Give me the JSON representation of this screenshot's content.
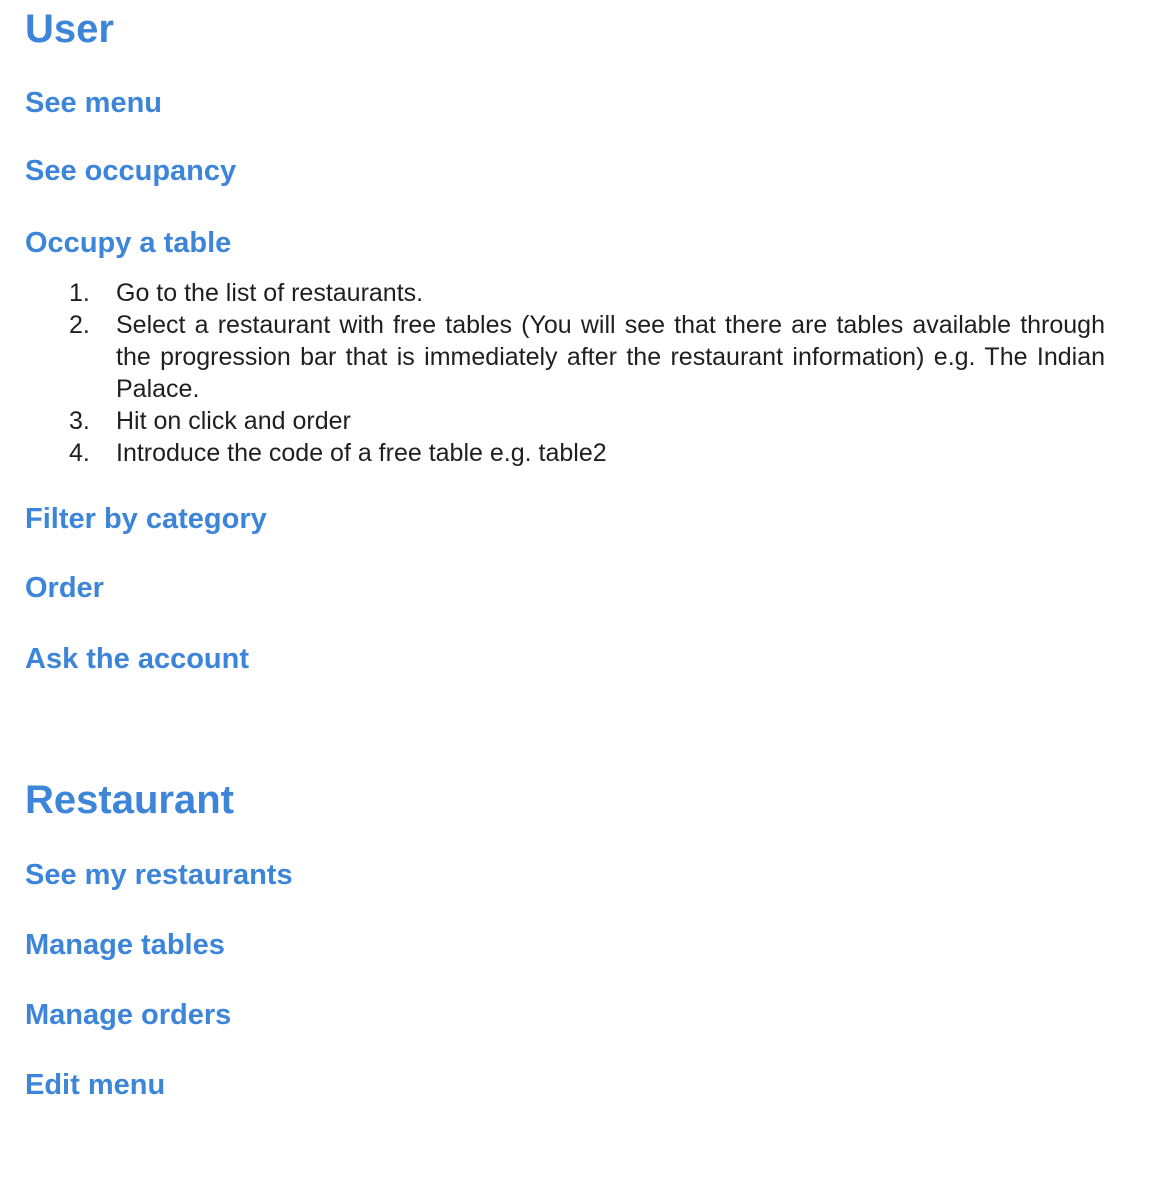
{
  "user": {
    "title": "User",
    "sections": {
      "see_menu": "See menu",
      "see_occupancy": "See occupancy",
      "occupy_table": "Occupy a table",
      "filter_category": "Filter by category",
      "order": "Order",
      "ask_account": "Ask the account"
    },
    "occupy_steps": [
      {
        "num": "1.",
        "text": "Go to the list of restaurants."
      },
      {
        "num": "2.",
        "text": "Select a restaurant with free tables (You will see that there are tables available through the progression bar that is immediately after the restaurant information) e.g. The Indian Palace."
      },
      {
        "num": "3.",
        "text": "Hit on click and order"
      },
      {
        "num": "4.",
        "text": "Introduce the code of a free table e.g. table2"
      }
    ]
  },
  "restaurant": {
    "title": "Restaurant",
    "sections": {
      "see_my_restaurants": "See my restaurants",
      "manage_tables": "Manage tables",
      "manage_orders": "Manage orders",
      "edit_menu": "Edit menu"
    }
  },
  "colors": {
    "heading": "#3d85d8",
    "body_text": "#1f1f1f"
  }
}
